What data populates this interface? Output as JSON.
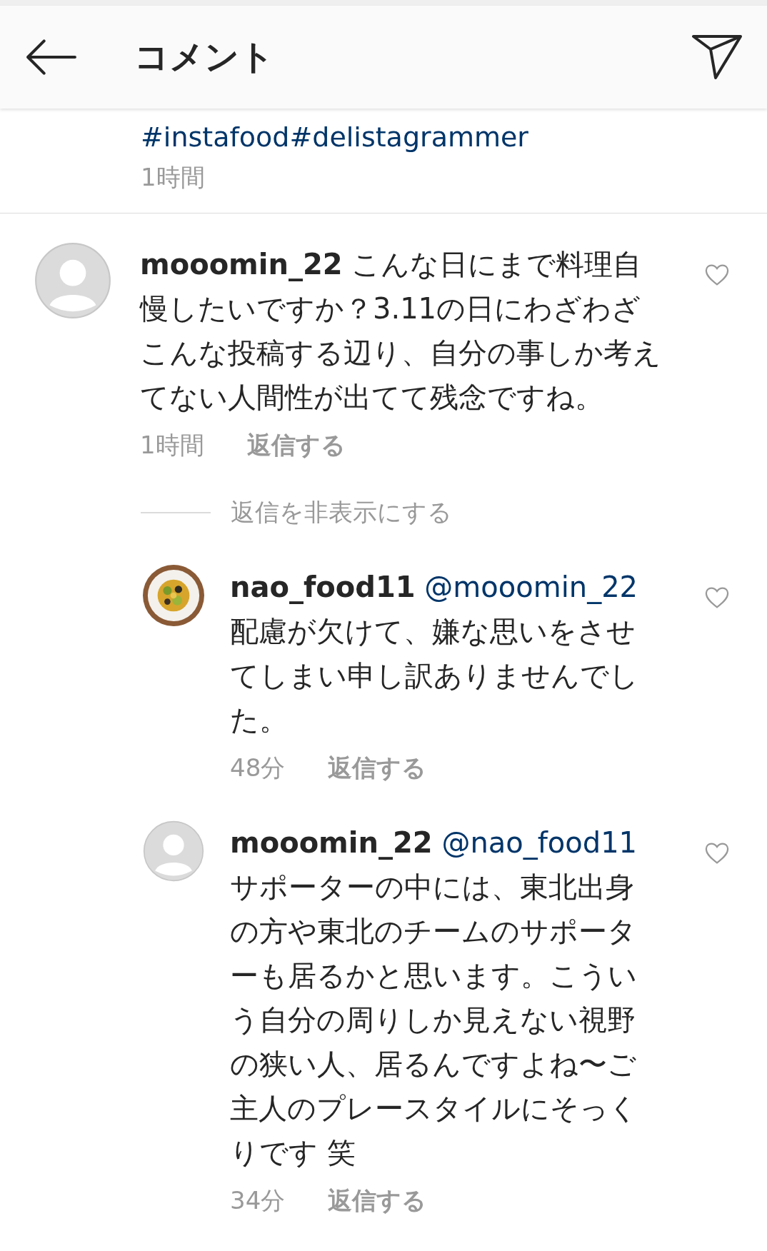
{
  "header": {
    "title": "コメント"
  },
  "caption": {
    "hashtags": "#instafood#delistagrammer",
    "time": "1時間"
  },
  "comments": [
    {
      "avatar": {
        "kind": "placeholder"
      },
      "user": "mooomin_22",
      "text": "こんな日にまで料理自慢したいですか？3.11の日にわざわざこんな投稿する辺り、自分の事しか考えてない人間性が出てて残念ですね。",
      "time": "1時間",
      "reply_label": "返信する",
      "liked": false,
      "replies_toggle": "返信を非表示にする",
      "children": [
        {
          "user": "nao_food11",
          "mention": "@mooomin_22",
          "text": "配慮が欠けて、嫌な思いをさせてしまい申し訳ありませんでした。",
          "time": "48分",
          "reply_label": "返信する",
          "liked": false
        },
        {
          "avatar": {
            "kind": "placeholder"
          },
          "user": "mooomin_22",
          "mention": "@nao_food11",
          "text": "サポーターの中には、東北出身の方や東北のチームのサポーターも居るかと思います。こういう自分の周りしか見えない視野の狭い人、居るんですよね〜ご主人のプレースタイルにそっくりです 笑",
          "time": "34分",
          "reply_label": "返信する",
          "liked": false
        }
      ]
    }
  ]
}
